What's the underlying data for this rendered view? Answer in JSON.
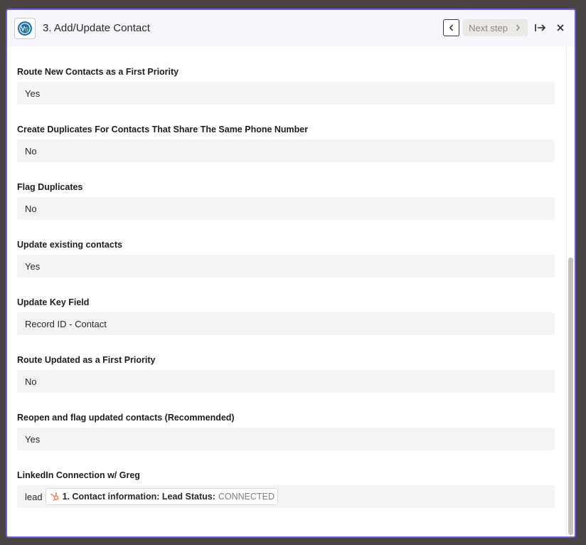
{
  "header": {
    "title": "3. Add/Update Contact",
    "app_icon": "vs-app-logo",
    "next_label": "Next step"
  },
  "fields": [
    {
      "label": "Route New Contacts as a First Priority",
      "value": "Yes"
    },
    {
      "label": "Create Duplicates For Contacts That Share The Same Phone Number",
      "value": "No"
    },
    {
      "label": "Flag Duplicates",
      "value": "No"
    },
    {
      "label": "Update existing contacts",
      "value": "Yes"
    },
    {
      "label": "Update Key Field",
      "value": "Record ID - Contact"
    },
    {
      "label": "Route Updated as a First Priority",
      "value": "No"
    },
    {
      "label": "Reopen and flag updated contacts (Recommended)",
      "value": "Yes"
    }
  ],
  "linkedin": {
    "label": "LinkedIn Connection w/ Greg",
    "prefix": "lead",
    "pill_icon": "hubspot-icon",
    "pill_label": "1. Contact information: Lead Status:",
    "pill_value": "CONNECTED"
  },
  "colors": {
    "accent_border": "#6b5ce7",
    "hubspot": "#ff7a59"
  }
}
